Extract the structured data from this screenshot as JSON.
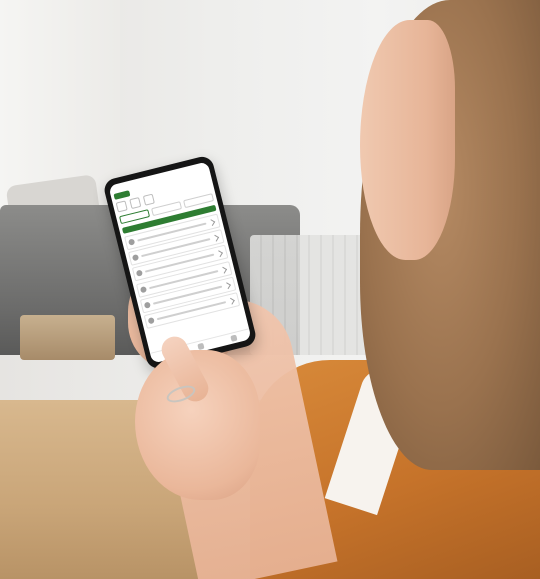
{
  "photo": {
    "subject": "",
    "palette": {
      "background": "#eeeeec",
      "sofa": "#6b6b6a",
      "table": "#c9a578",
      "shirt": "#c6732a",
      "hair": "#9a724e",
      "phone_frame": "#151515",
      "app_accent": "#2e7d32"
    }
  },
  "phone_ui": {
    "cards": [
      {
        "icon": "thermometer-icon"
      },
      {
        "icon": "plug-icon"
      },
      {
        "icon": "flame-icon"
      },
      {
        "icon": "home-icon"
      },
      {
        "icon": "wifi-icon"
      },
      {
        "icon": "gear-icon"
      }
    ],
    "nav": [
      {
        "icon": "home-icon"
      },
      {
        "icon": "grid-icon"
      },
      {
        "icon": "user-icon"
      }
    ]
  }
}
